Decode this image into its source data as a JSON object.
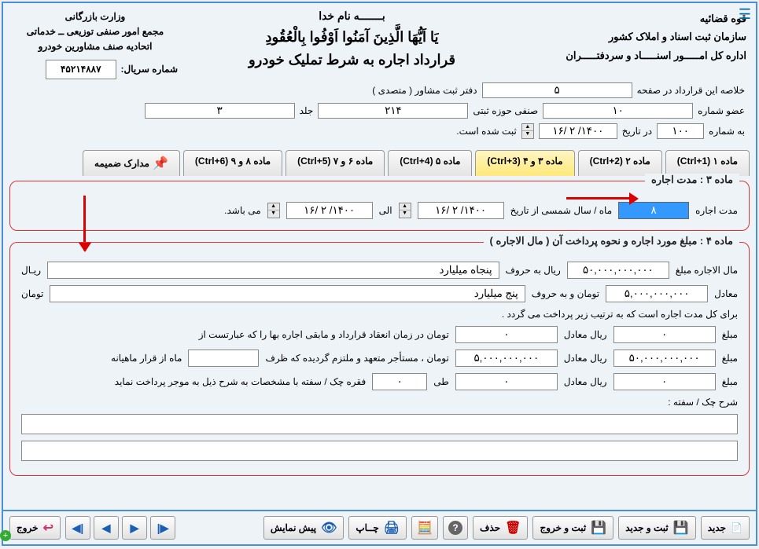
{
  "header": {
    "right1": "قوه قضائیه",
    "right2": "سازمان ثبت اسناد و املاک کشور",
    "right3": "اداره کل امـــــور اسنـــــاد و سردفتـــــران",
    "bismillah": "بـــــــه نام خدا",
    "verse": "یَا اَیُّهَا الَّذِینَ آمَنُوا اَوْفُوا بِالْعُقُودِ",
    "contract_title": "قرارداد اجاره به شرط تملیک خودرو",
    "left1": "وزارت بازرگانی",
    "left2": "مجمع امور صنفی توزیعی ــ خدماتی",
    "left3": "اتحادیه صنف مشاورین خودرو",
    "serial_label": "شماره سریال:",
    "serial_value": "۴۵۲۱۴۸۸۷"
  },
  "summary": {
    "line1_a": "خلاصه این قرارداد در صفحه",
    "page_value": "۵",
    "line1_b": "دفتر ثبت مشاور  ( متصدی )",
    "line2_a": "عضو شماره",
    "member_value": "۱۰",
    "line2_b": "صنفی حوزه ثبتی",
    "zone_value": "۲۱۴",
    "line2_c": "جلد",
    "volume_value": "۳",
    "line3_a": "به شماره",
    "number_value": "۱۰۰",
    "line3_b": "در تاریخ",
    "date_value": "۱۴۰۰/ ۲ /۱۶",
    "line3_c": "ثبت شده است."
  },
  "tabs": [
    {
      "label": "ماده ۱  (Ctrl+1)"
    },
    {
      "label": "ماده ۲  (Ctrl+2)"
    },
    {
      "label": "ماده ۳ و ۴  (Ctrl+3)",
      "active": true
    },
    {
      "label": "ماده ۵  (Ctrl+4)"
    },
    {
      "label": "ماده ۶ و ۷  (Ctrl+5)"
    },
    {
      "label": "ماده ۸ و ۹  (Ctrl+6)"
    },
    {
      "label": "مدارک ضمیمه",
      "attach": true
    }
  ],
  "section3": {
    "title": "ماده ۳ : مدت اجاره",
    "duration_label": "مدت اجاره",
    "duration_value": "۸",
    "unit_label": "ماه / سال شمسی از تاریخ",
    "from_date": "۱۴۰۰/ ۲ /۱۶",
    "to_label": "الی",
    "to_date": "۱۴۰۰/ ۲ /۱۶",
    "end_label": "می باشد."
  },
  "section4": {
    "title": "ماده ۴ : مبلغ مورد اجاره و نحوه پرداخت آن ( مال الاجاره )",
    "rent_label": "مال الاجاره مبلغ",
    "rent_value": "۵۰,۰۰۰,۰۰۰,۰۰۰",
    "rial_words_label": "ریال به حروف",
    "rial_words_value": "پنجاه میلیارد",
    "rial_unit": "ریـال",
    "equiv_label": "معادل",
    "equiv_value": "۵,۰۰۰,۰۰۰,۰۰۰",
    "toman_words_label": "تومان و به حروف",
    "toman_words_value": "پنج میلیارد",
    "toman_unit": "تومان",
    "note_line": "برای کل مدت اجاره است که به ترتیب زیر پرداخت می گردد .",
    "row1": {
      "a": "مبلغ",
      "av": "۰",
      "b": "ریال معادل",
      "bv": "۰",
      "c": "تومان در زمان انعقاد قرارداد و مابقی اجاره بها را که عبارتست از"
    },
    "row2": {
      "a": "مبلغ",
      "av": "۵۰,۰۰۰,۰۰۰,۰۰۰",
      "b": "ریال معادل",
      "bv": "۵,۰۰۰,۰۰۰,۰۰۰",
      "c": "تومان ، مستأجر متعهد و ملتزم گردیده که ظرف",
      "d": "ماه از قرار ماهیانه",
      "dv": ""
    },
    "row3": {
      "a": "مبلغ",
      "av": "۰",
      "b": "ریال معادل",
      "bv": "۰",
      "c": "طی",
      "cv": "۰",
      "d": "فقره چک / سفته با مشخصات به شرح ذیل به موجر پرداخت نماید"
    },
    "cheque_label": "شرح چک / سفته :"
  },
  "toolbar": {
    "new": "جدید",
    "save_new": "ثبت و جدید",
    "save_exit": "ثبت و خروج",
    "delete": "حذف",
    "print": "چــاپ",
    "preview": "پیش نمایش",
    "exit": "خروج"
  }
}
